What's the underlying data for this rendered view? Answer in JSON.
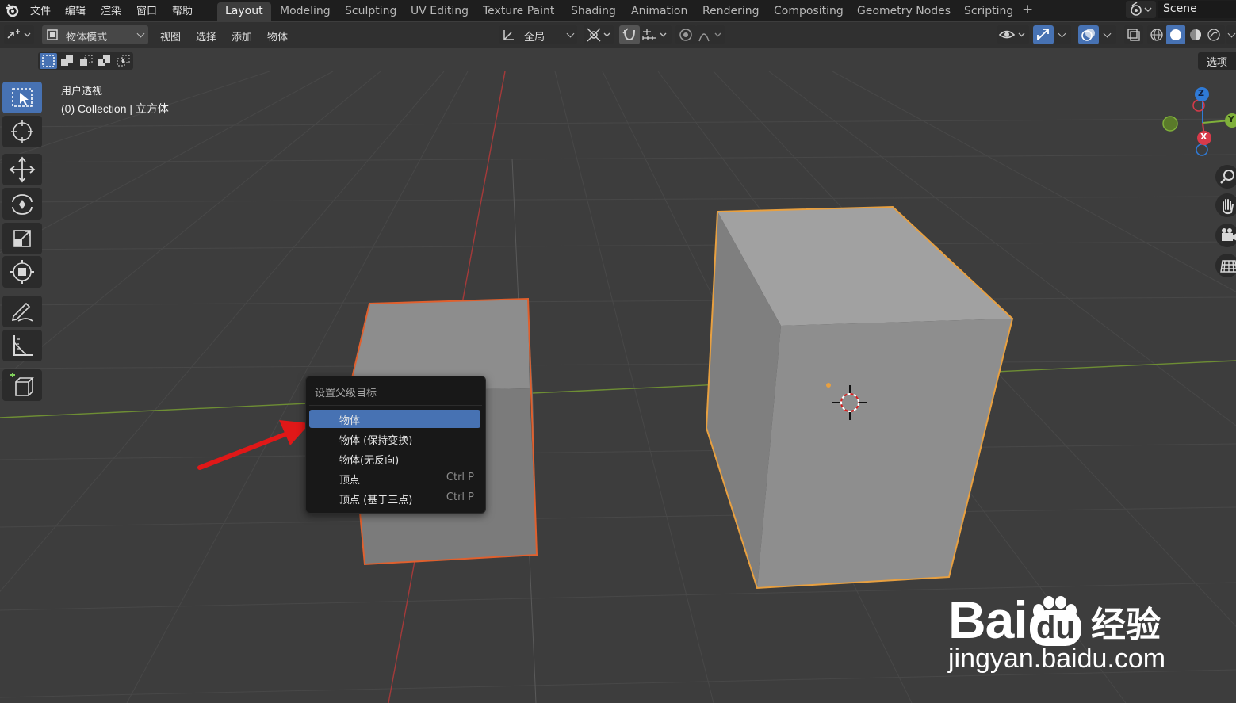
{
  "menu": {
    "items": [
      "文件",
      "编辑",
      "渲染",
      "窗口",
      "帮助"
    ]
  },
  "workspaces": {
    "tabs": [
      "Layout",
      "Modeling",
      "Sculpting",
      "UV Editing",
      "Texture Paint",
      "Shading",
      "Animation",
      "Rendering",
      "Compositing",
      "Geometry Nodes",
      "Scripting"
    ],
    "active": "Layout",
    "add_symbol": "+"
  },
  "scene": {
    "name": "Scene"
  },
  "header": {
    "mode": "物体模式",
    "view": "视图",
    "select": "选择",
    "add": "添加",
    "object": "物体",
    "transform_orientation": "全局"
  },
  "viewport": {
    "view_name": "用户透视",
    "collection_info": "(0) Collection | 立方体",
    "options_label": "选项"
  },
  "gizmo": {
    "z": "Z",
    "x": "X",
    "y": "Y"
  },
  "popup": {
    "title": "设置父级目标",
    "items": [
      {
        "label": "物体",
        "shortcut": "",
        "selected": true
      },
      {
        "label": "物体 (保持变换)",
        "shortcut": ""
      },
      {
        "label": "物体(无反向)",
        "shortcut": ""
      },
      {
        "label": "顶点",
        "shortcut": "Ctrl P"
      },
      {
        "label": "顶点 (基于三点)",
        "shortcut": "Ctrl P"
      }
    ]
  },
  "watermark": {
    "brand": "Bai",
    "brand2": "du",
    "suffix": "经验",
    "url": "jingyan.baidu.com"
  },
  "colors": {
    "accent": "#4772b3",
    "selected_outline": "#e8a040",
    "active_outline": "#e06030",
    "axis_x": "#c04040",
    "axis_y": "#7a9a40",
    "arrow": "#e01818"
  }
}
